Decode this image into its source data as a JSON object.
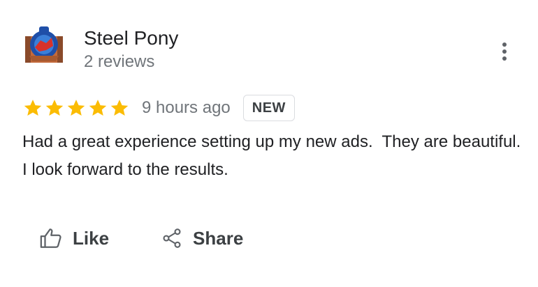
{
  "review": {
    "author_name": "Steel Pony",
    "author_reviews": "2 reviews",
    "rating": 5,
    "max_rating": 5,
    "time_ago": "9 hours ago",
    "badge": "NEW",
    "text": "Had a great experience setting up my new ads.  They are beautiful.  I look forward to the results."
  },
  "actions": {
    "like_label": "Like",
    "share_label": "Share"
  },
  "icons": {
    "avatar": "avatar",
    "more": "more-vert-icon",
    "star": "star-icon",
    "like": "thumb-up-icon",
    "share": "share-icon"
  },
  "colors": {
    "star": "#fbbc04",
    "text_primary": "#202124",
    "text_secondary": "#70757a",
    "badge_border": "#dadce0",
    "icon": "#5f6368"
  }
}
